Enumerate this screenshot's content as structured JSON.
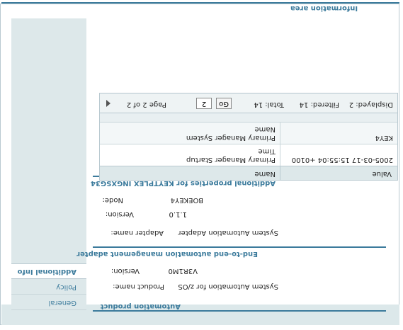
{
  "information_area": {
    "title": "Information area"
  },
  "sidebar": {
    "tabs": [
      {
        "label": "General"
      },
      {
        "label": "Policy"
      },
      {
        "label": "Additional Info"
      }
    ]
  },
  "automation_product": {
    "title": "Automation product",
    "product_name_label": "Product name:",
    "product_name_value": "System Automation for z/OS",
    "version_label": "Version:",
    "version_value": "V3R1M0"
  },
  "adapter": {
    "title": "End-to-end automation management adapter",
    "adapter_name_label": "Adapter name:",
    "adapter_name_value": "System Automation Adapter",
    "version_label": "Version:",
    "version_value": "1.1.0",
    "node_label": "Node:",
    "node_value": "BOEKEY4"
  },
  "additional_properties": {
    "title": "Additional properties for KEYTPLEX INGXSG34",
    "columns": [
      "Name",
      "Value"
    ],
    "rows": [
      {
        "name_line1": "Primary Manager Startup",
        "name_line2": "Time",
        "value": "2005-03-17 15:55:04 +0100"
      },
      {
        "name_line1": "Primary Manager System",
        "name_line2": "Name",
        "value": "KEY4"
      }
    ],
    "pager": {
      "page_text": "Page 2 of 2",
      "page_input": "2",
      "go_label": "Go",
      "total": "Total: 14",
      "filtered": "Filtered: 14",
      "displayed": "Displayed: 2"
    }
  },
  "colors": {
    "accent": "#3c7b9c",
    "panel": "#dde8ea"
  }
}
